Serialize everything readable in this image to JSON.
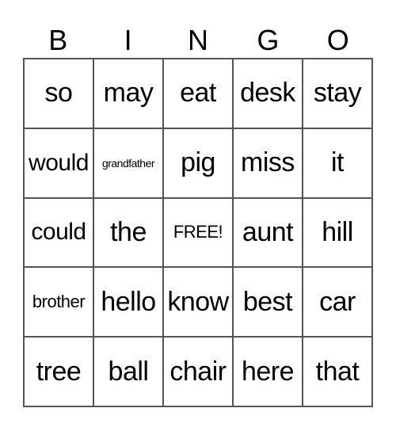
{
  "header": [
    "B",
    "I",
    "N",
    "G",
    "O"
  ],
  "cells": [
    [
      "so",
      "may",
      "eat",
      "desk",
      "stay"
    ],
    [
      "would",
      "grandfather",
      "pig",
      "miss",
      "it"
    ],
    [
      "could",
      "the",
      "FREE!",
      "aunt",
      "hill"
    ],
    [
      "brother",
      "hello",
      "know",
      "best",
      "car"
    ],
    [
      "tree",
      "ball",
      "chair",
      "here",
      "that"
    ]
  ]
}
